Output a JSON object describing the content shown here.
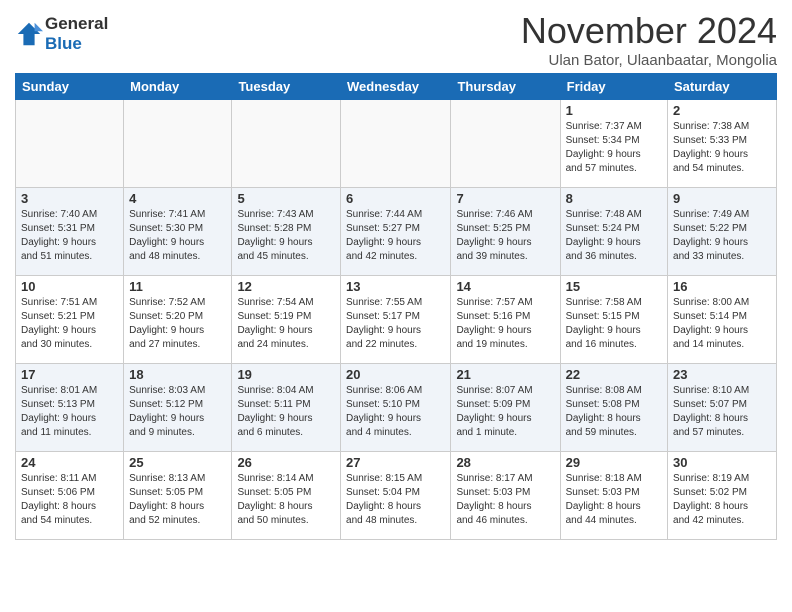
{
  "header": {
    "logo_line1": "General",
    "logo_line2": "Blue",
    "title": "November 2024",
    "subtitle": "Ulan Bator, Ulaanbaatar, Mongolia"
  },
  "columns": [
    "Sunday",
    "Monday",
    "Tuesday",
    "Wednesday",
    "Thursday",
    "Friday",
    "Saturday"
  ],
  "weeks": [
    {
      "days": [
        {
          "num": "",
          "info": ""
        },
        {
          "num": "",
          "info": ""
        },
        {
          "num": "",
          "info": ""
        },
        {
          "num": "",
          "info": ""
        },
        {
          "num": "",
          "info": ""
        },
        {
          "num": "1",
          "info": "Sunrise: 7:37 AM\nSunset: 5:34 PM\nDaylight: 9 hours\nand 57 minutes."
        },
        {
          "num": "2",
          "info": "Sunrise: 7:38 AM\nSunset: 5:33 PM\nDaylight: 9 hours\nand 54 minutes."
        }
      ]
    },
    {
      "days": [
        {
          "num": "3",
          "info": "Sunrise: 7:40 AM\nSunset: 5:31 PM\nDaylight: 9 hours\nand 51 minutes."
        },
        {
          "num": "4",
          "info": "Sunrise: 7:41 AM\nSunset: 5:30 PM\nDaylight: 9 hours\nand 48 minutes."
        },
        {
          "num": "5",
          "info": "Sunrise: 7:43 AM\nSunset: 5:28 PM\nDaylight: 9 hours\nand 45 minutes."
        },
        {
          "num": "6",
          "info": "Sunrise: 7:44 AM\nSunset: 5:27 PM\nDaylight: 9 hours\nand 42 minutes."
        },
        {
          "num": "7",
          "info": "Sunrise: 7:46 AM\nSunset: 5:25 PM\nDaylight: 9 hours\nand 39 minutes."
        },
        {
          "num": "8",
          "info": "Sunrise: 7:48 AM\nSunset: 5:24 PM\nDaylight: 9 hours\nand 36 minutes."
        },
        {
          "num": "9",
          "info": "Sunrise: 7:49 AM\nSunset: 5:22 PM\nDaylight: 9 hours\nand 33 minutes."
        }
      ]
    },
    {
      "days": [
        {
          "num": "10",
          "info": "Sunrise: 7:51 AM\nSunset: 5:21 PM\nDaylight: 9 hours\nand 30 minutes."
        },
        {
          "num": "11",
          "info": "Sunrise: 7:52 AM\nSunset: 5:20 PM\nDaylight: 9 hours\nand 27 minutes."
        },
        {
          "num": "12",
          "info": "Sunrise: 7:54 AM\nSunset: 5:19 PM\nDaylight: 9 hours\nand 24 minutes."
        },
        {
          "num": "13",
          "info": "Sunrise: 7:55 AM\nSunset: 5:17 PM\nDaylight: 9 hours\nand 22 minutes."
        },
        {
          "num": "14",
          "info": "Sunrise: 7:57 AM\nSunset: 5:16 PM\nDaylight: 9 hours\nand 19 minutes."
        },
        {
          "num": "15",
          "info": "Sunrise: 7:58 AM\nSunset: 5:15 PM\nDaylight: 9 hours\nand 16 minutes."
        },
        {
          "num": "16",
          "info": "Sunrise: 8:00 AM\nSunset: 5:14 PM\nDaylight: 9 hours\nand 14 minutes."
        }
      ]
    },
    {
      "days": [
        {
          "num": "17",
          "info": "Sunrise: 8:01 AM\nSunset: 5:13 PM\nDaylight: 9 hours\nand 11 minutes."
        },
        {
          "num": "18",
          "info": "Sunrise: 8:03 AM\nSunset: 5:12 PM\nDaylight: 9 hours\nand 9 minutes."
        },
        {
          "num": "19",
          "info": "Sunrise: 8:04 AM\nSunset: 5:11 PM\nDaylight: 9 hours\nand 6 minutes."
        },
        {
          "num": "20",
          "info": "Sunrise: 8:06 AM\nSunset: 5:10 PM\nDaylight: 9 hours\nand 4 minutes."
        },
        {
          "num": "21",
          "info": "Sunrise: 8:07 AM\nSunset: 5:09 PM\nDaylight: 9 hours\nand 1 minute."
        },
        {
          "num": "22",
          "info": "Sunrise: 8:08 AM\nSunset: 5:08 PM\nDaylight: 8 hours\nand 59 minutes."
        },
        {
          "num": "23",
          "info": "Sunrise: 8:10 AM\nSunset: 5:07 PM\nDaylight: 8 hours\nand 57 minutes."
        }
      ]
    },
    {
      "days": [
        {
          "num": "24",
          "info": "Sunrise: 8:11 AM\nSunset: 5:06 PM\nDaylight: 8 hours\nand 54 minutes."
        },
        {
          "num": "25",
          "info": "Sunrise: 8:13 AM\nSunset: 5:05 PM\nDaylight: 8 hours\nand 52 minutes."
        },
        {
          "num": "26",
          "info": "Sunrise: 8:14 AM\nSunset: 5:05 PM\nDaylight: 8 hours\nand 50 minutes."
        },
        {
          "num": "27",
          "info": "Sunrise: 8:15 AM\nSunset: 5:04 PM\nDaylight: 8 hours\nand 48 minutes."
        },
        {
          "num": "28",
          "info": "Sunrise: 8:17 AM\nSunset: 5:03 PM\nDaylight: 8 hours\nand 46 minutes."
        },
        {
          "num": "29",
          "info": "Sunrise: 8:18 AM\nSunset: 5:03 PM\nDaylight: 8 hours\nand 44 minutes."
        },
        {
          "num": "30",
          "info": "Sunrise: 8:19 AM\nSunset: 5:02 PM\nDaylight: 8 hours\nand 42 minutes."
        }
      ]
    }
  ]
}
